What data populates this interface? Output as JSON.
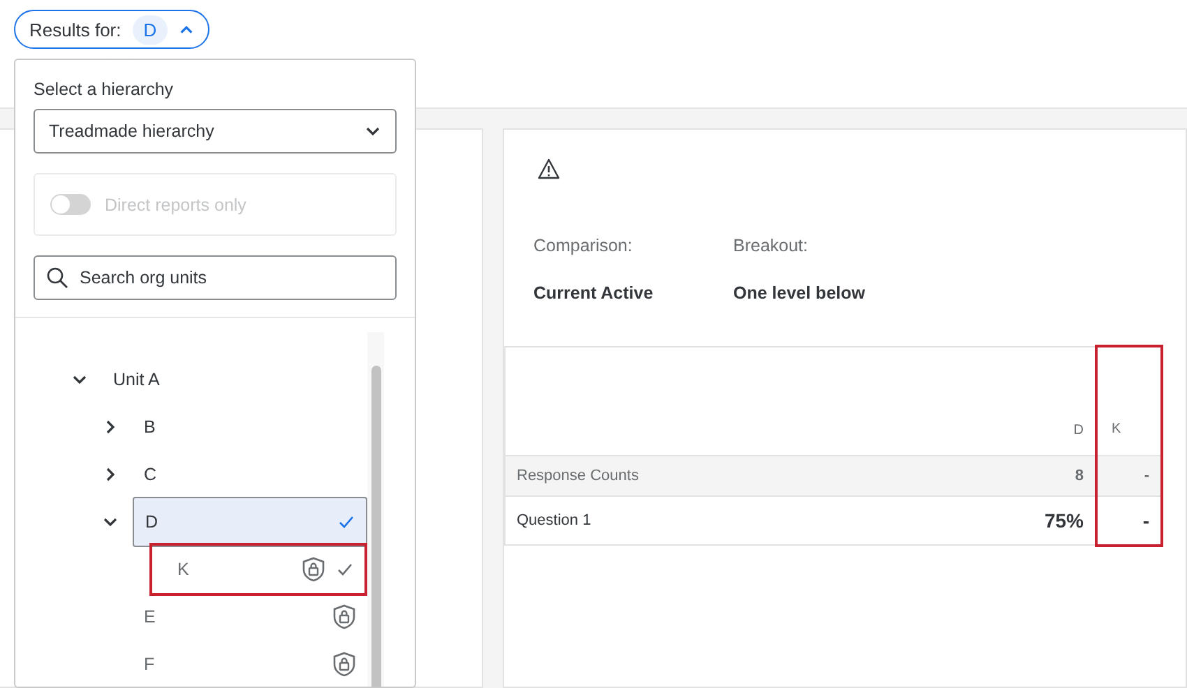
{
  "results_button": {
    "label": "Results for:",
    "value": "D",
    "expanded": true
  },
  "popover": {
    "hierarchy_label": "Select a hierarchy",
    "hierarchy_value": "Treadmade hierarchy",
    "direct_reports": {
      "label": "Direct reports only",
      "on": false,
      "disabled": true
    },
    "search": {
      "placeholder": "Search org units"
    },
    "tree": [
      {
        "label": "Unit A",
        "expanded": true,
        "selected": false,
        "locked": false,
        "included": false,
        "highlighted": false,
        "children": [
          {
            "label": "B",
            "expanded": false,
            "selected": false,
            "locked": false,
            "included": false,
            "highlighted": false
          },
          {
            "label": "C",
            "expanded": false,
            "selected": false,
            "locked": false,
            "included": false,
            "highlighted": false
          },
          {
            "label": "D",
            "expanded": true,
            "selected": true,
            "locked": false,
            "included": false,
            "highlighted": false,
            "children": [
              {
                "label": "K",
                "selected": false,
                "locked": true,
                "included": true,
                "highlighted": true
              }
            ]
          },
          {
            "label": "E",
            "selected": false,
            "locked": true,
            "included": false,
            "highlighted": false
          },
          {
            "label": "F",
            "selected": false,
            "locked": true,
            "included": false,
            "highlighted": false
          }
        ]
      }
    ]
  },
  "report": {
    "comparison_label": "Comparison:",
    "comparison_value": "Current Active",
    "breakout_label": "Breakout:",
    "breakout_value": "One level below",
    "table": {
      "columns": [
        {
          "label": "D",
          "highlighted": false
        },
        {
          "label": "K",
          "highlighted": true
        }
      ],
      "rows": [
        {
          "label": "Response Counts",
          "kind": "count",
          "cells": [
            "8",
            "-"
          ]
        },
        {
          "label": "Question 1",
          "kind": "percent",
          "cells": [
            "75%",
            "-"
          ]
        }
      ]
    }
  }
}
